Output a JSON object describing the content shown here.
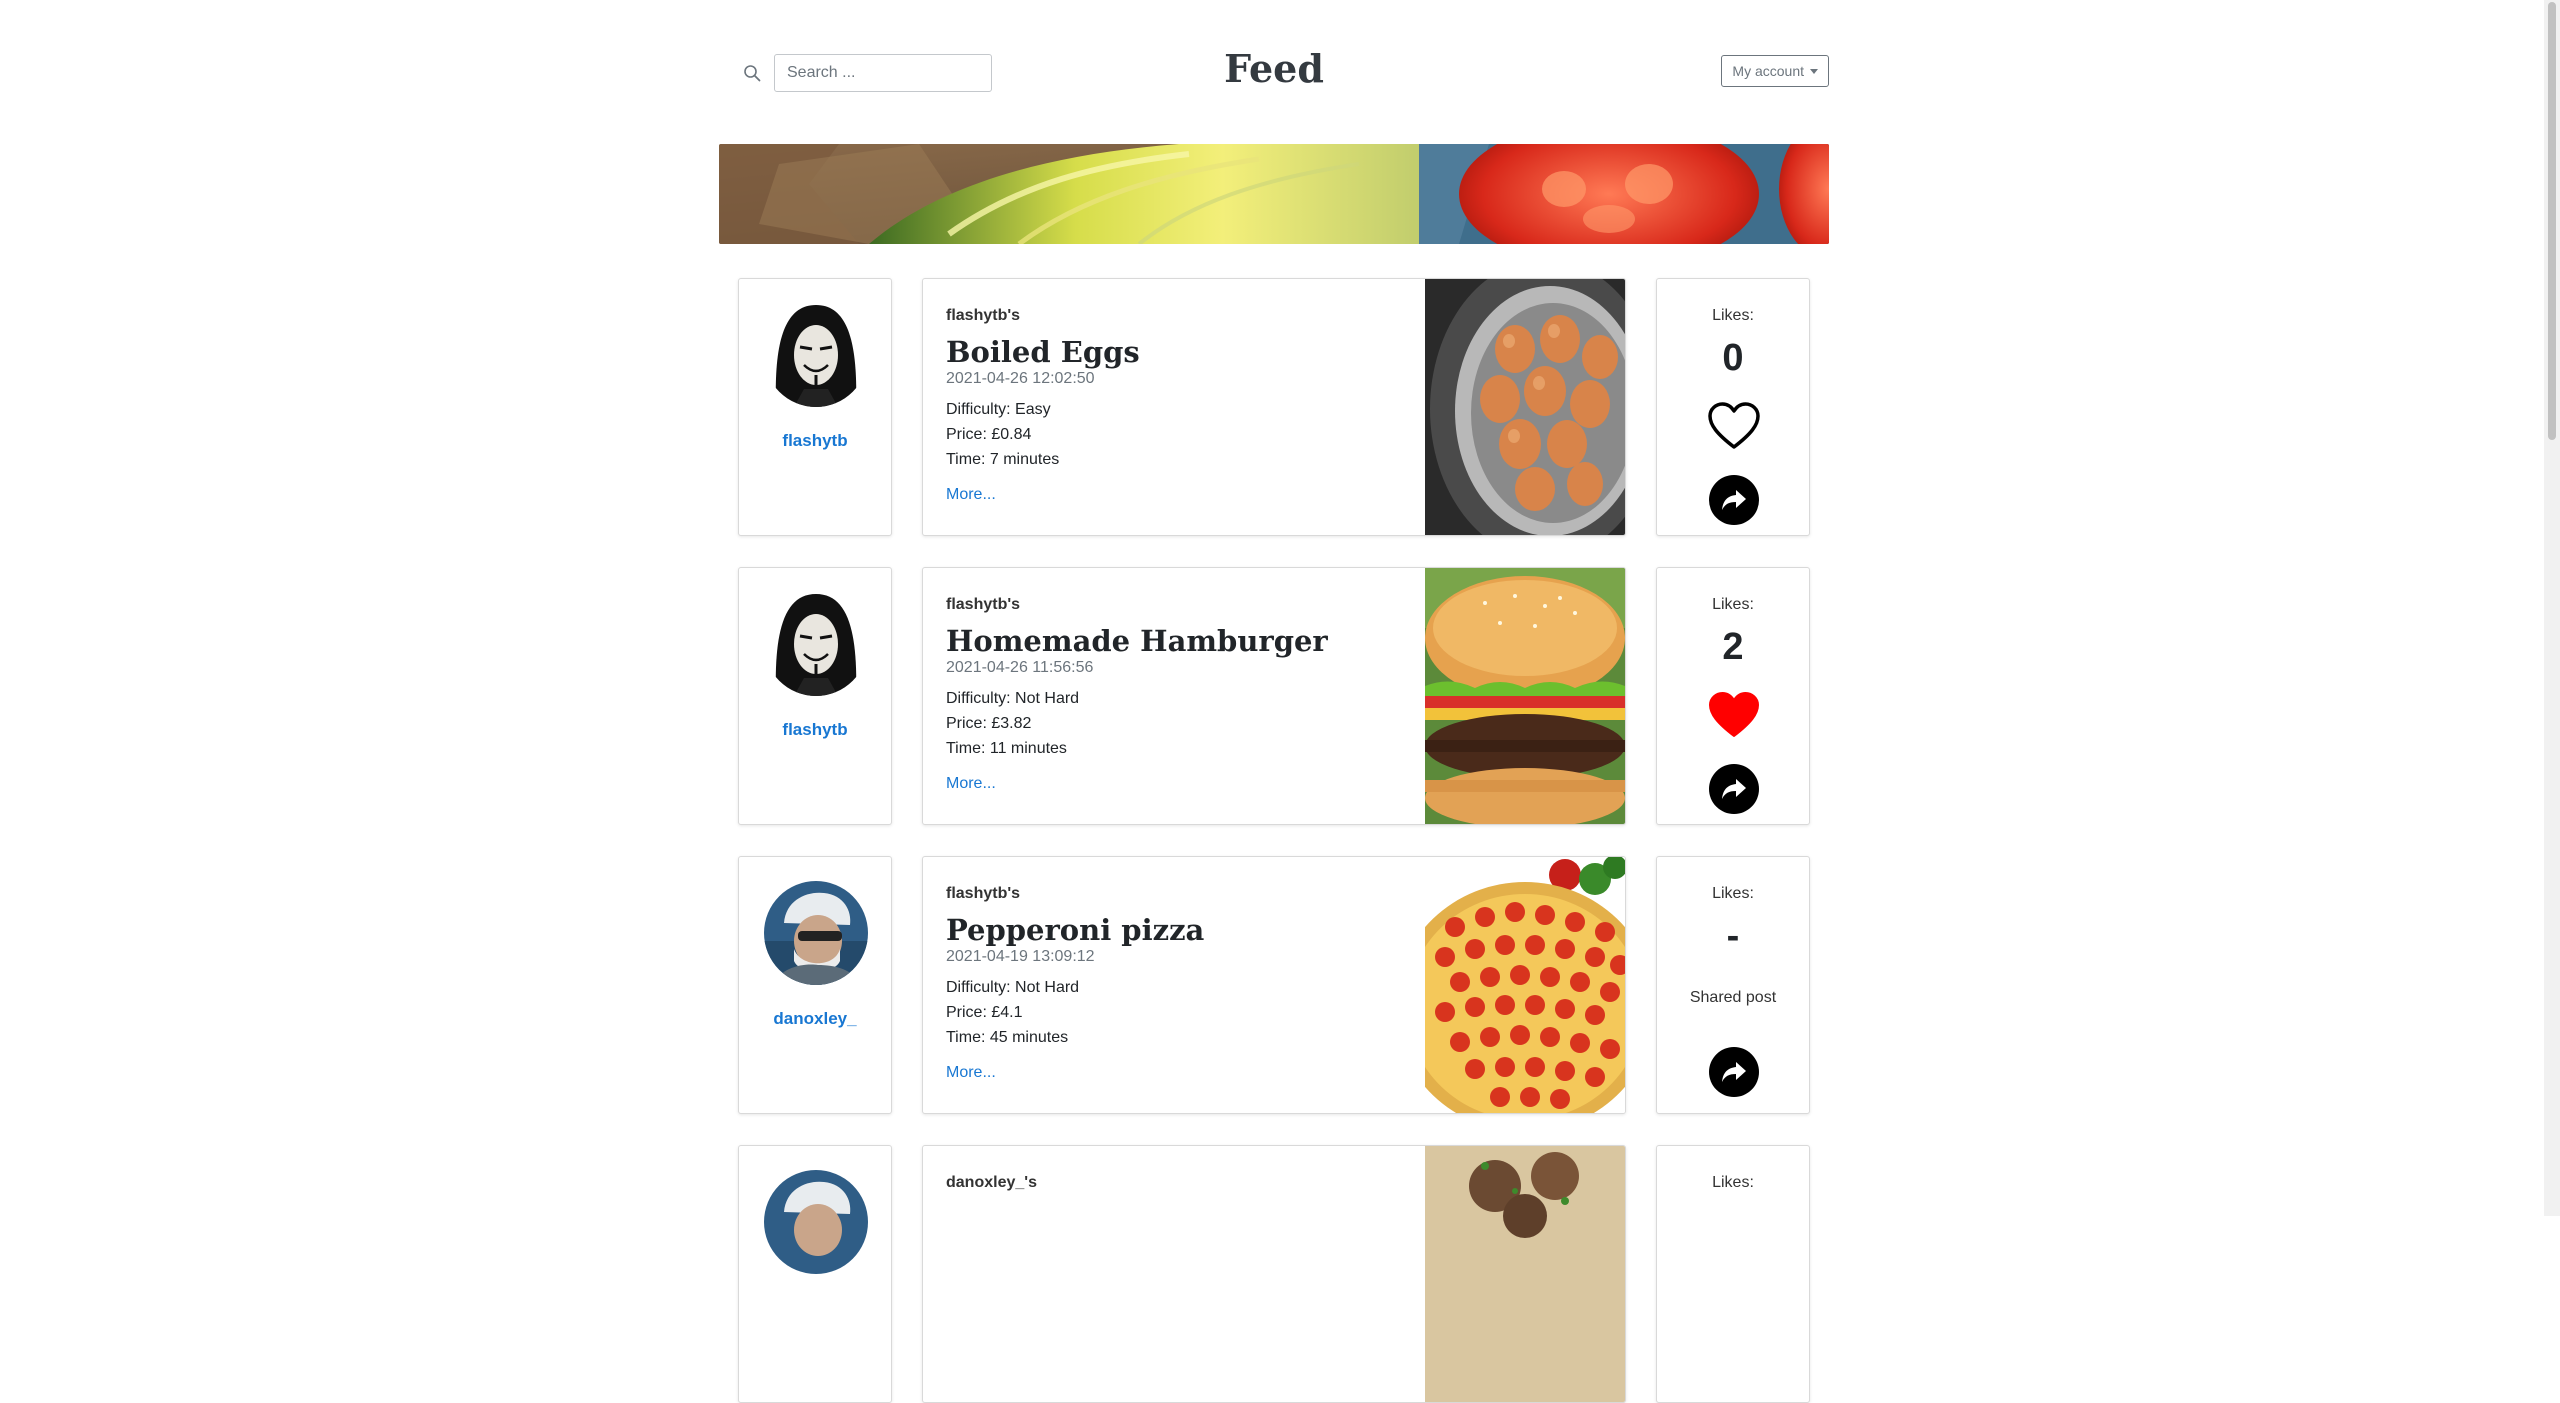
{
  "header": {
    "title": "Feed",
    "search_placeholder": "Search ...",
    "account_label": "My account"
  },
  "posts": [
    {
      "username": "flashytb",
      "owner": "flashytb's",
      "title": "Boiled Eggs",
      "date": "2021-04-26 12:02:50",
      "difficulty": "Difficulty: Easy",
      "price": "Price: £0.84",
      "time": "Time: 7 minutes",
      "more": "More...",
      "likes_label": "Likes:",
      "likes": "0",
      "liked": false
    },
    {
      "username": "flashytb",
      "owner": "flashytb's",
      "title": "Homemade Hamburger",
      "date": "2021-04-26 11:56:56",
      "difficulty": "Difficulty: Not Hard",
      "price": "Price: £3.82",
      "time": "Time: 11 minutes",
      "more": "More...",
      "likes_label": "Likes:",
      "likes": "2",
      "liked": true
    },
    {
      "username": "danoxley_",
      "owner": "flashytb's",
      "title": "Pepperoni pizza",
      "date": "2021-04-19 13:09:12",
      "difficulty": "Difficulty: Not Hard",
      "price": "Price: £4.1",
      "time": "Time: 45 minutes",
      "more": "More...",
      "likes_label": "Likes:",
      "likes": "-",
      "shared_text": "Shared post"
    },
    {
      "owner": "danoxley_'s",
      "likes_label": "Likes:"
    }
  ],
  "colors": {
    "link": "#1877d2",
    "heart_liked": "#ff0000",
    "share_button": "#000000"
  },
  "icons": [
    "search-icon",
    "heart-outline-icon",
    "heart-filled-icon",
    "share-arrow-icon"
  ]
}
